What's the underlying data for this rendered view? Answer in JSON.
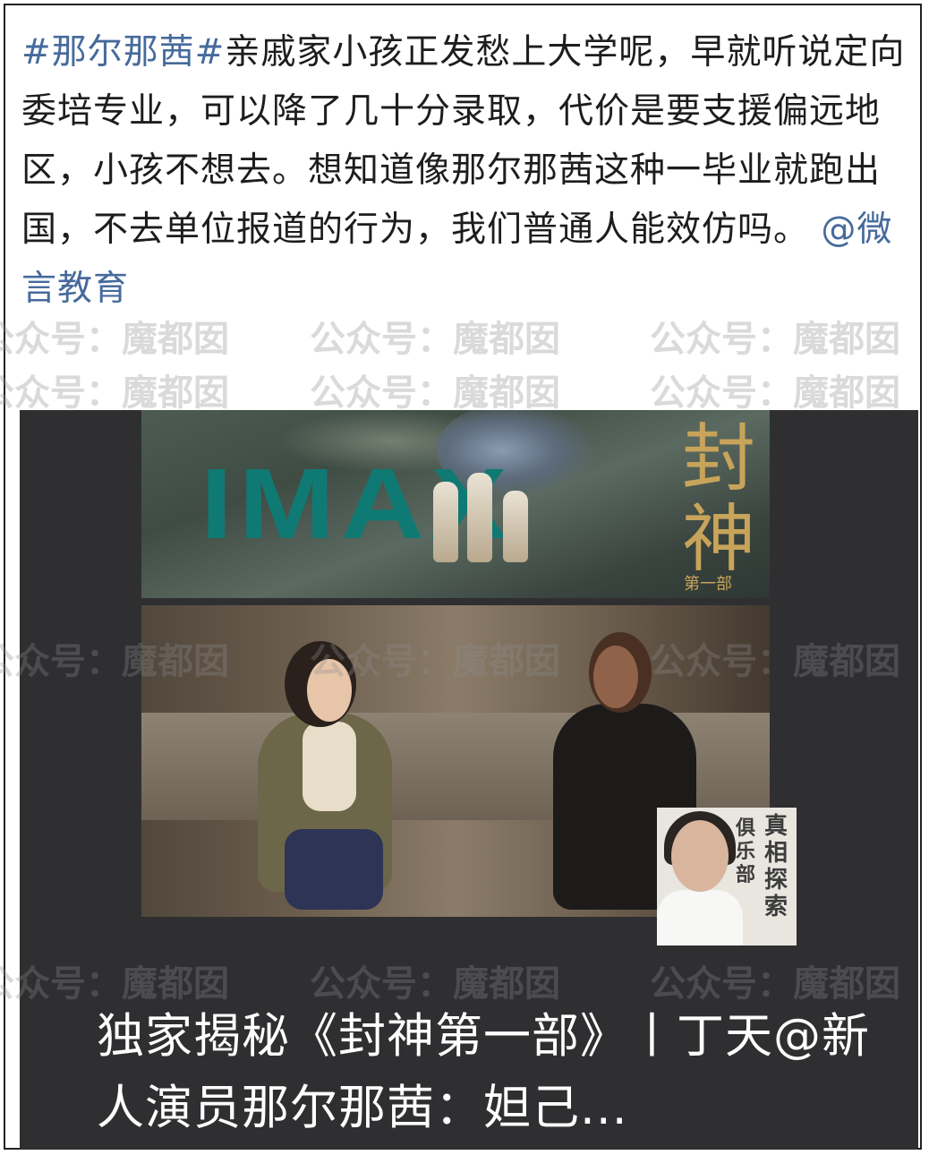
{
  "post": {
    "hashtag": "#那尔那茜#",
    "body": "亲戚家小孩正发愁上大学呢，早就听说定向委培专业，可以降了几十分录取，代价是要支援偏远地区，小孩不想去。想知道像那尔那茜这种一毕业就跑出国，不去单位报道的行为，我们普通人能效仿吗。",
    "mention": "@微言教育"
  },
  "video": {
    "poster_brand": "IMAX",
    "poster_title": "封神",
    "poster_subtitle": "第一部",
    "badge_title": "真相探索",
    "badge_side": "俱乐部",
    "caption": "独家揭秘《封神第一部》丨丁天@新人演员那尔那茜：妲己..."
  },
  "watermark": {
    "text": "公众号：魔都囡"
  }
}
